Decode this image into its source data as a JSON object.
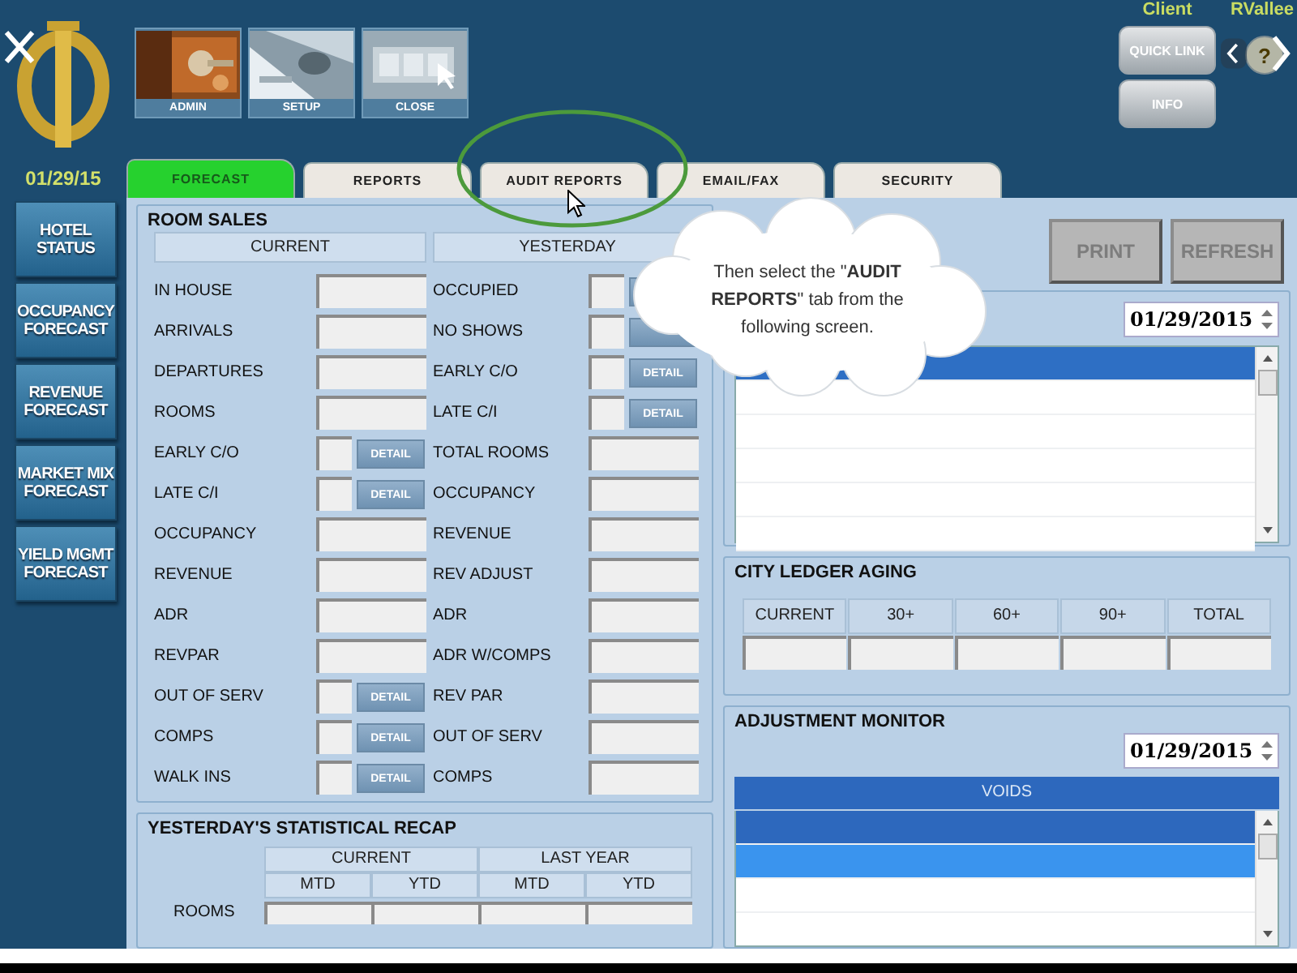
{
  "header": {
    "toolbar": [
      {
        "label": "ADMIN",
        "kind": "keys"
      },
      {
        "label": "SETUP",
        "kind": "keyboard"
      },
      {
        "label": "CLOSE",
        "kind": "window"
      }
    ],
    "client_label": "Client",
    "user_label": "RVallee",
    "quick_link": "QUICK LINK",
    "info": "INFO",
    "help": "?"
  },
  "date": "01/29/15",
  "tabs": [
    {
      "label": "FORECAST",
      "selected": true
    },
    {
      "label": "REPORTS",
      "selected": false
    },
    {
      "label": "AUDIT REPORTS",
      "selected": false
    },
    {
      "label": "EMAIL/FAX",
      "selected": false
    },
    {
      "label": "SECURITY",
      "selected": false
    }
  ],
  "sidebar": {
    "items": [
      {
        "label": "HOTEL STATUS"
      },
      {
        "label": "OCCUPANCY FORECAST"
      },
      {
        "label": "REVENUE FORECAST"
      },
      {
        "label": "MARKET MIX FORECAST"
      },
      {
        "label": "YIELD MGMT FORECAST"
      }
    ]
  },
  "room_sales": {
    "title": "ROOM SALES",
    "columns": [
      "CURRENT",
      "YESTERDAY"
    ],
    "current_rows": [
      {
        "label": "IN HOUSE",
        "kind": "wide"
      },
      {
        "label": "ARRIVALS",
        "kind": "wide"
      },
      {
        "label": "DEPARTURES",
        "kind": "wide"
      },
      {
        "label": "ROOMS",
        "kind": "wide"
      },
      {
        "label": "EARLY C/O",
        "kind": "detail",
        "detail": "DETAIL"
      },
      {
        "label": "LATE C/I",
        "kind": "detail",
        "detail": "DETAIL"
      },
      {
        "label": "OCCUPANCY",
        "kind": "wide"
      },
      {
        "label": "REVENUE",
        "kind": "wide"
      },
      {
        "label": "ADR",
        "kind": "wide"
      },
      {
        "label": "REVPAR",
        "kind": "wide"
      },
      {
        "label": "OUT OF SERV",
        "kind": "detail",
        "detail": "DETAIL"
      },
      {
        "label": "COMPS",
        "kind": "detail",
        "detail": "DETAIL"
      },
      {
        "label": "WALK INS",
        "kind": "detail",
        "detail": "DETAIL"
      }
    ],
    "yesterday_rows": [
      {
        "label": "OCCUPIED",
        "kind": "detail"
      },
      {
        "label": "NO SHOWS",
        "kind": "detail"
      },
      {
        "label": "EARLY C/O",
        "kind": "detail",
        "detail": "DETAIL"
      },
      {
        "label": "LATE C/I",
        "kind": "detail",
        "detail": "DETAIL"
      },
      {
        "label": "TOTAL ROOMS",
        "kind": "wide"
      },
      {
        "label": "OCCUPANCY",
        "kind": "wide"
      },
      {
        "label": "REVENUE",
        "kind": "wide"
      },
      {
        "label": "REV ADJUST",
        "kind": "wide"
      },
      {
        "label": "ADR",
        "kind": "wide"
      },
      {
        "label": "ADR W/COMPS",
        "kind": "wide"
      },
      {
        "label": "REV PAR",
        "kind": "wide"
      },
      {
        "label": "OUT OF SERV",
        "kind": "wide"
      },
      {
        "label": "COMPS",
        "kind": "wide"
      }
    ]
  },
  "recap": {
    "title": "YESTERDAY'S STATISTICAL RECAP",
    "groups": [
      "CURRENT",
      "LAST YEAR"
    ],
    "columns": [
      "MTD",
      "YTD",
      "MTD",
      "YTD"
    ],
    "rows": [
      {
        "label": "ROOMS"
      }
    ]
  },
  "actions": [
    {
      "label": "PRINT",
      "disabled": true
    },
    {
      "label": "REFRESH",
      "disabled": true
    }
  ],
  "report_list": {
    "date": "01/29/2015",
    "rows": [
      {
        "selected": true
      },
      {
        "selected": false
      },
      {
        "selected": false
      },
      {
        "selected": false
      },
      {
        "selected": false
      },
      {
        "selected": false
      }
    ]
  },
  "city_ledger": {
    "title": "CITY LEDGER AGING",
    "columns": [
      "CURRENT",
      "30+",
      "60+",
      "90+",
      "TOTAL"
    ]
  },
  "adjustment_monitor": {
    "title": "ADJUSTMENT MONITOR",
    "date": "01/29/2015",
    "header": "VOIDS",
    "rows": [
      {
        "selected": true,
        "hovered": false
      },
      {
        "selected": false,
        "hovered": true
      },
      {
        "selected": false,
        "hovered": false
      }
    ]
  },
  "callout": {
    "text": "Then select the \"**AUDIT REPORTS**\" tab from the following screen."
  }
}
